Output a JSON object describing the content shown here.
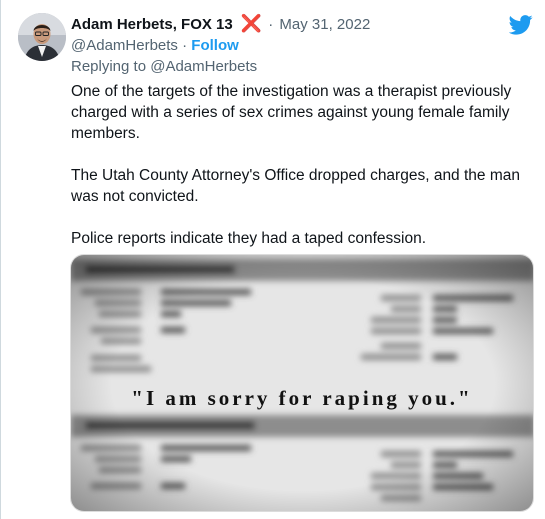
{
  "tweet": {
    "author_name": "Adam Herbets, FOX 13",
    "name_emoji": "❌",
    "separator": "·",
    "date": "May 31, 2022",
    "handle": "@AdamHerbets",
    "follow_label": "Follow",
    "reply_prefix": "Replying to",
    "reply_handle": "@AdamHerbets",
    "paragraphs": [
      "One of the targets of the investigation was a therapist previously charged with a series of sex crimes against young female family members.",
      "The Utah County Attorney's Office dropped charges, and the man was not convicted.",
      "Police reports indicate they had a taped confession."
    ],
    "media_caption": "\"I am sorry for raping you.\""
  },
  "icons": {
    "logo": "twitter-bird-icon",
    "emoji": "cross-mark-icon"
  },
  "colors": {
    "accent": "#1d9bf0",
    "secondary_text": "#536471",
    "emoji_red": "#e0245e"
  }
}
